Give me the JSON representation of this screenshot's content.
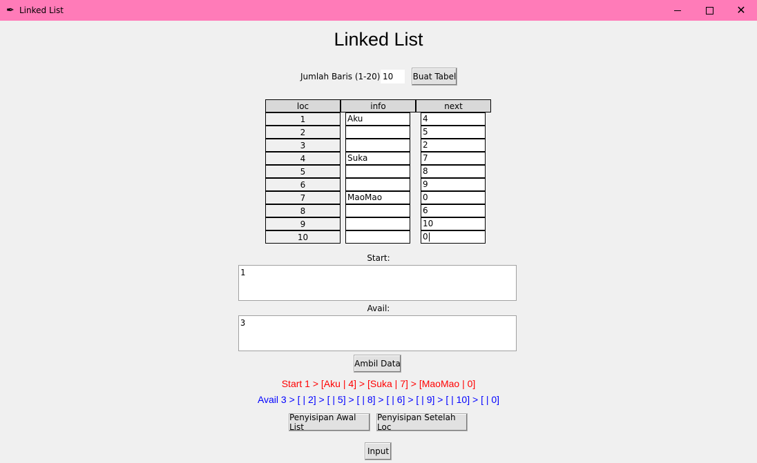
{
  "window": {
    "title": "Linked List",
    "colors": {
      "titlebar": "#ff7bb8"
    }
  },
  "heading": "Linked List",
  "row_count": {
    "label": "Jumlah Baris (1-20):",
    "value": "10",
    "button_label": "Buat Tabel"
  },
  "table": {
    "headers": [
      "loc",
      "info",
      "next"
    ],
    "rows": [
      {
        "loc": "1",
        "info": "Aku",
        "next": "4"
      },
      {
        "loc": "2",
        "info": "",
        "next": "5"
      },
      {
        "loc": "3",
        "info": "",
        "next": "2"
      },
      {
        "loc": "4",
        "info": "Suka",
        "next": "7"
      },
      {
        "loc": "5",
        "info": "",
        "next": "8"
      },
      {
        "loc": "6",
        "info": "",
        "next": "9"
      },
      {
        "loc": "7",
        "info": "MaoMao",
        "next": "0"
      },
      {
        "loc": "8",
        "info": "",
        "next": "6"
      },
      {
        "loc": "9",
        "info": "",
        "next": "10"
      },
      {
        "loc": "10",
        "info": "",
        "next": "0"
      }
    ]
  },
  "start": {
    "label": "Start:",
    "value": "1"
  },
  "avail": {
    "label": "Avail:",
    "value": "3"
  },
  "ambil_button": "Ambil Data",
  "output": {
    "start_line": "Start 1 > [Aku | 4] > [Suka | 7] > [MaoMao | 0]",
    "avail_line": "Avail 3 > [ | 2] > [ | 5] > [ | 8] > [ | 6] > [ | 9] > [ | 10] > [ | 0]",
    "start_color": "#ff0000",
    "avail_color": "#0000ff"
  },
  "buttons": {
    "insert_front": "Penyisipan Awal List",
    "insert_after": "Penyisipan Setelah Loc",
    "input": "Input"
  }
}
